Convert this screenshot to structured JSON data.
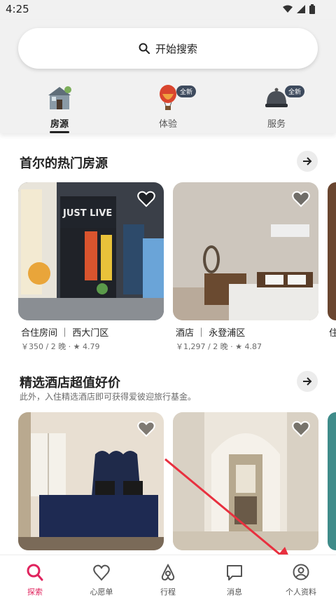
{
  "status": {
    "time": "4:25"
  },
  "search": {
    "label": "开始搜索"
  },
  "categories": [
    {
      "label": "房源",
      "active": true,
      "badge": ""
    },
    {
      "label": "体验",
      "active": false,
      "badge": "全新"
    },
    {
      "label": "服务",
      "active": false,
      "badge": "全新"
    }
  ],
  "section1": {
    "title": "首尔的热门房源",
    "cards": [
      {
        "title": "合住房间 ｜ 西大门区",
        "meta": "￥350 / 2 晚 · ★ 4.79"
      },
      {
        "title": "酒店 ｜ 永登浦区",
        "meta": "￥1,297 / 2 晚 · ★ 4.87"
      },
      {
        "title": "住",
        "meta": ""
      }
    ],
    "storefront_sign": "JUST LIVE"
  },
  "section2": {
    "title": "精选酒店超值好价",
    "subtitle": "此外，入住精选酒店即可获得爱彼迎旅行基金。"
  },
  "nav": [
    {
      "label": "探索",
      "icon": "search-icon",
      "active": true
    },
    {
      "label": "心愿单",
      "icon": "heart-icon",
      "active": false
    },
    {
      "label": "行程",
      "icon": "airbnb-logo-icon",
      "active": false
    },
    {
      "label": "消息",
      "icon": "message-icon",
      "active": false
    },
    {
      "label": "个人资料",
      "icon": "profile-icon",
      "active": false
    }
  ],
  "colors": {
    "accent": "#e0245e",
    "annotation_arrow": "#e8303f",
    "badge": "#3e4b5e"
  }
}
